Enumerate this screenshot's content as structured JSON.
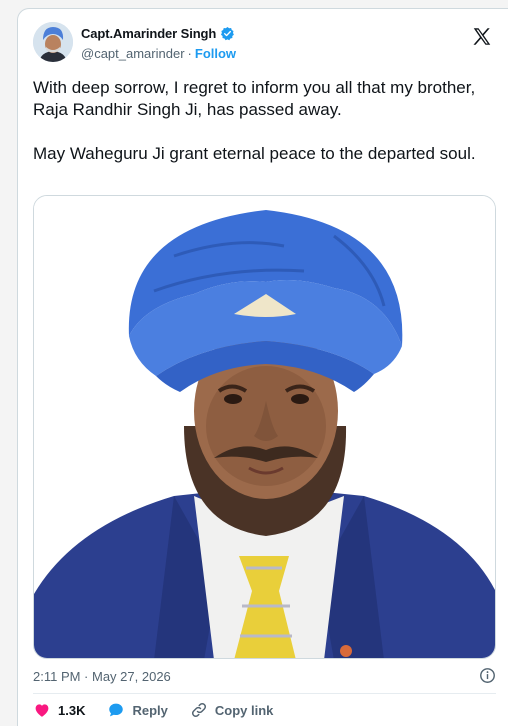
{
  "author": {
    "display_name": "Capt.Amarinder Singh",
    "handle": "@capt_amarinder",
    "separator": "·",
    "follow_label": "Follow"
  },
  "tweet": {
    "paragraph1": "With deep sorrow, I regret to inform you all that my brother, Raja Randhir Singh Ji, has passed away.",
    "paragraph2": "May Waheguru Ji grant eternal peace to the departed soul."
  },
  "timestamp": "2:11 PM · May 27, 2026",
  "actions": {
    "like_count": "1.3K",
    "reply_label": "Reply",
    "copy_link_label": "Copy link"
  },
  "colors": {
    "accent": "#1d9bf0",
    "like": "#f91880",
    "turban": "#3b6fd6",
    "suit": "#2c3f8f",
    "tie": "#e9cf3a"
  },
  "icons": {
    "verified": "verified-badge-icon",
    "brand": "x-logo-icon",
    "info": "info-icon",
    "like": "heart-icon",
    "reply": "reply-bubble-icon",
    "copy_link": "link-icon"
  }
}
